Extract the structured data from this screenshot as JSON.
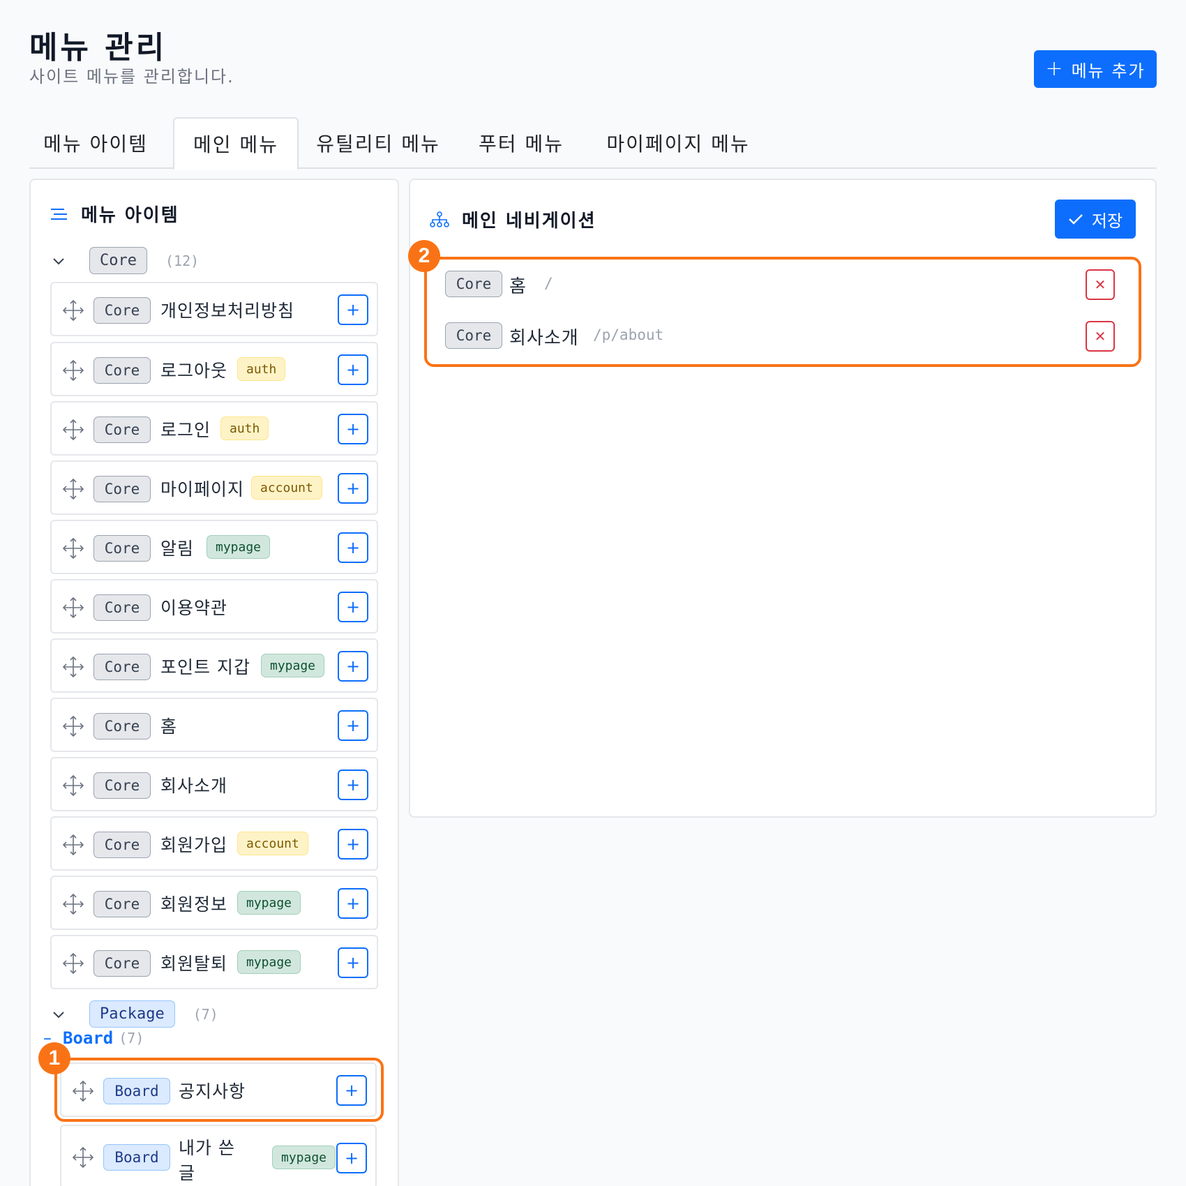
{
  "header": {
    "title": "메뉴 관리",
    "subtitle": "사이트 메뉴를 관리합니다.",
    "add_button": "메뉴 추가"
  },
  "tabs": [
    {
      "label": "메뉴 아이템",
      "active": false
    },
    {
      "label": "메인 메뉴",
      "active": true
    },
    {
      "label": "유틸리티 메뉴",
      "active": false
    },
    {
      "label": "푸터 메뉴",
      "active": false
    },
    {
      "label": "마이페이지 메뉴",
      "active": false
    }
  ],
  "left_panel": {
    "title": "메뉴 아이템",
    "groups": [
      {
        "name": "Core",
        "count": "(12)",
        "items": [
          {
            "badge": "Core",
            "label": "개인정보처리방침",
            "tag": ""
          },
          {
            "badge": "Core",
            "label": "로그아웃",
            "tag": "auth"
          },
          {
            "badge": "Core",
            "label": "로그인",
            "tag": "auth"
          },
          {
            "badge": "Core",
            "label": "마이페이지",
            "tag": "account"
          },
          {
            "badge": "Core",
            "label": "알림",
            "tag": "mypage"
          },
          {
            "badge": "Core",
            "label": "이용약관",
            "tag": ""
          },
          {
            "badge": "Core",
            "label": "포인트 지갑",
            "tag": "mypage"
          },
          {
            "badge": "Core",
            "label": "홈",
            "tag": ""
          },
          {
            "badge": "Core",
            "label": "회사소개",
            "tag": ""
          },
          {
            "badge": "Core",
            "label": "회원가입",
            "tag": "account"
          },
          {
            "badge": "Core",
            "label": "회원정보",
            "tag": "mypage"
          },
          {
            "badge": "Core",
            "label": "회원탈퇴",
            "tag": "mypage"
          }
        ]
      },
      {
        "name": "Package",
        "count": "(7)",
        "subgroup": {
          "name": "Board",
          "count": "(7)"
        },
        "items": [
          {
            "badge": "Board",
            "label": "공지사항",
            "tag": ""
          },
          {
            "badge": "Board",
            "label_line1": "내가 쓴",
            "label_line2": "글",
            "tag": "mypage"
          }
        ]
      }
    ]
  },
  "right_panel": {
    "title": "메인 네비게이션",
    "save_button": "저장",
    "items": [
      {
        "badge": "Core",
        "label": "홈",
        "path": "/"
      },
      {
        "badge": "Core",
        "label": "회사소개",
        "path": "/p/about"
      }
    ]
  },
  "annotations": [
    "1",
    "2"
  ],
  "colors": {
    "accent": "#0d6efd",
    "highlight": "#f97316",
    "danger": "#dc3545"
  }
}
